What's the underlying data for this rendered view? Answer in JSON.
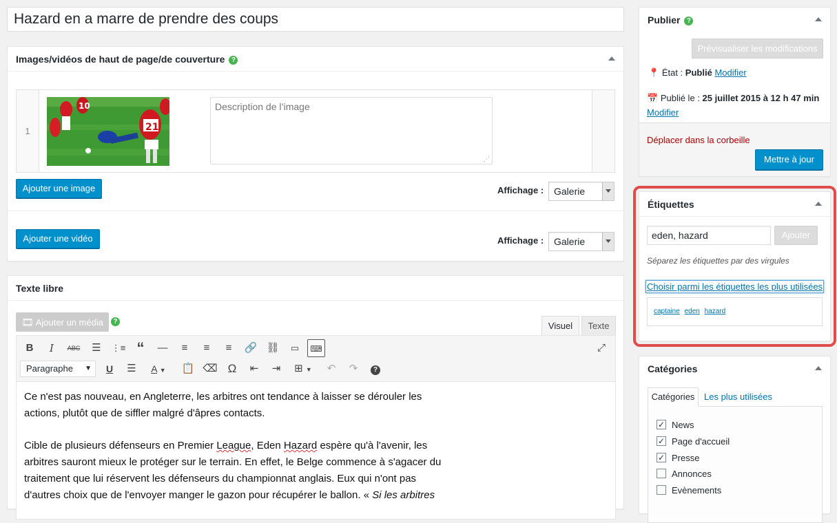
{
  "post": {
    "title": "Hazard en a marre de prendre des coups"
  },
  "cover": {
    "heading": "Images/vidéos de haut de page/de couverture",
    "row_number": "1",
    "desc_placeholder": "Description de l’image",
    "add_image": "Ajouter une image",
    "add_video": "Ajouter une vidéo",
    "display_label": "Affichage :",
    "display_value": "Galerie"
  },
  "freetext": {
    "heading": "Texte libre",
    "add_media": "Ajouter un média",
    "tab_visual": "Visuel",
    "tab_text": "Texte",
    "format_select": "Paragraphe",
    "para1_line1": "Ce n'est pas nouveau, en Angleterre, les arbitres ont tendance à laisser se dérouler les",
    "para1_line2": "actions, plutôt que de siffler malgré d'âpres contacts.",
    "para2_line1_a": "Cible de plusieurs défenseurs en Premier ",
    "para2_line1_b": "League",
    "para2_line1_c": ", Eden ",
    "para2_line1_d": "Hazard",
    "para2_line1_e": " espère qu'à l'avenir, les",
    "para2_line2": "arbitres sauront mieux le protéger sur le terrain. En effet, le Belge commence à s'agacer du",
    "para2_line3": "traitement que lui réservent les défenseurs du championnat anglais. Eux qui n'ont pas",
    "para2_line4_a": "d'autres choix que de l'envoyer manger le gazon pour récupérer le ballon. « ",
    "para2_line4_b": "Si les arbitres"
  },
  "publish": {
    "heading": "Publier",
    "preview": "Prévisualiser les modifications",
    "status_label": "État :",
    "status_value": "Publié",
    "modify": "Modifier",
    "published_label": "Publié le :",
    "published_value": "25 juillet 2015 à 12 h 47 min",
    "trash": "Déplacer dans la corbeille",
    "update": "Mettre à jour"
  },
  "tags": {
    "heading": "Étiquettes",
    "input_value": "eden, hazard",
    "add": "Ajouter",
    "hint": "Séparez les étiquettes par des virgules",
    "choose": "Choisir parmi les étiquettes les plus utilisées",
    "cloud": [
      "captaine",
      "eden",
      "hazard"
    ],
    "highlight_color": "#e04b4b"
  },
  "categories": {
    "heading": "Catégories",
    "tab_all": "Catégories",
    "tab_popular": "Les plus utilisées",
    "items": [
      {
        "label": "News",
        "checked": true
      },
      {
        "label": "Page d'accueil",
        "checked": true
      },
      {
        "label": "Presse",
        "checked": true
      },
      {
        "label": "Annonces",
        "checked": false
      },
      {
        "label": "Evènements",
        "checked": false
      }
    ]
  },
  "colors": {
    "primary": "#0091cd",
    "link": "#0073aa",
    "trash": "#a00",
    "help": "#46b450"
  }
}
